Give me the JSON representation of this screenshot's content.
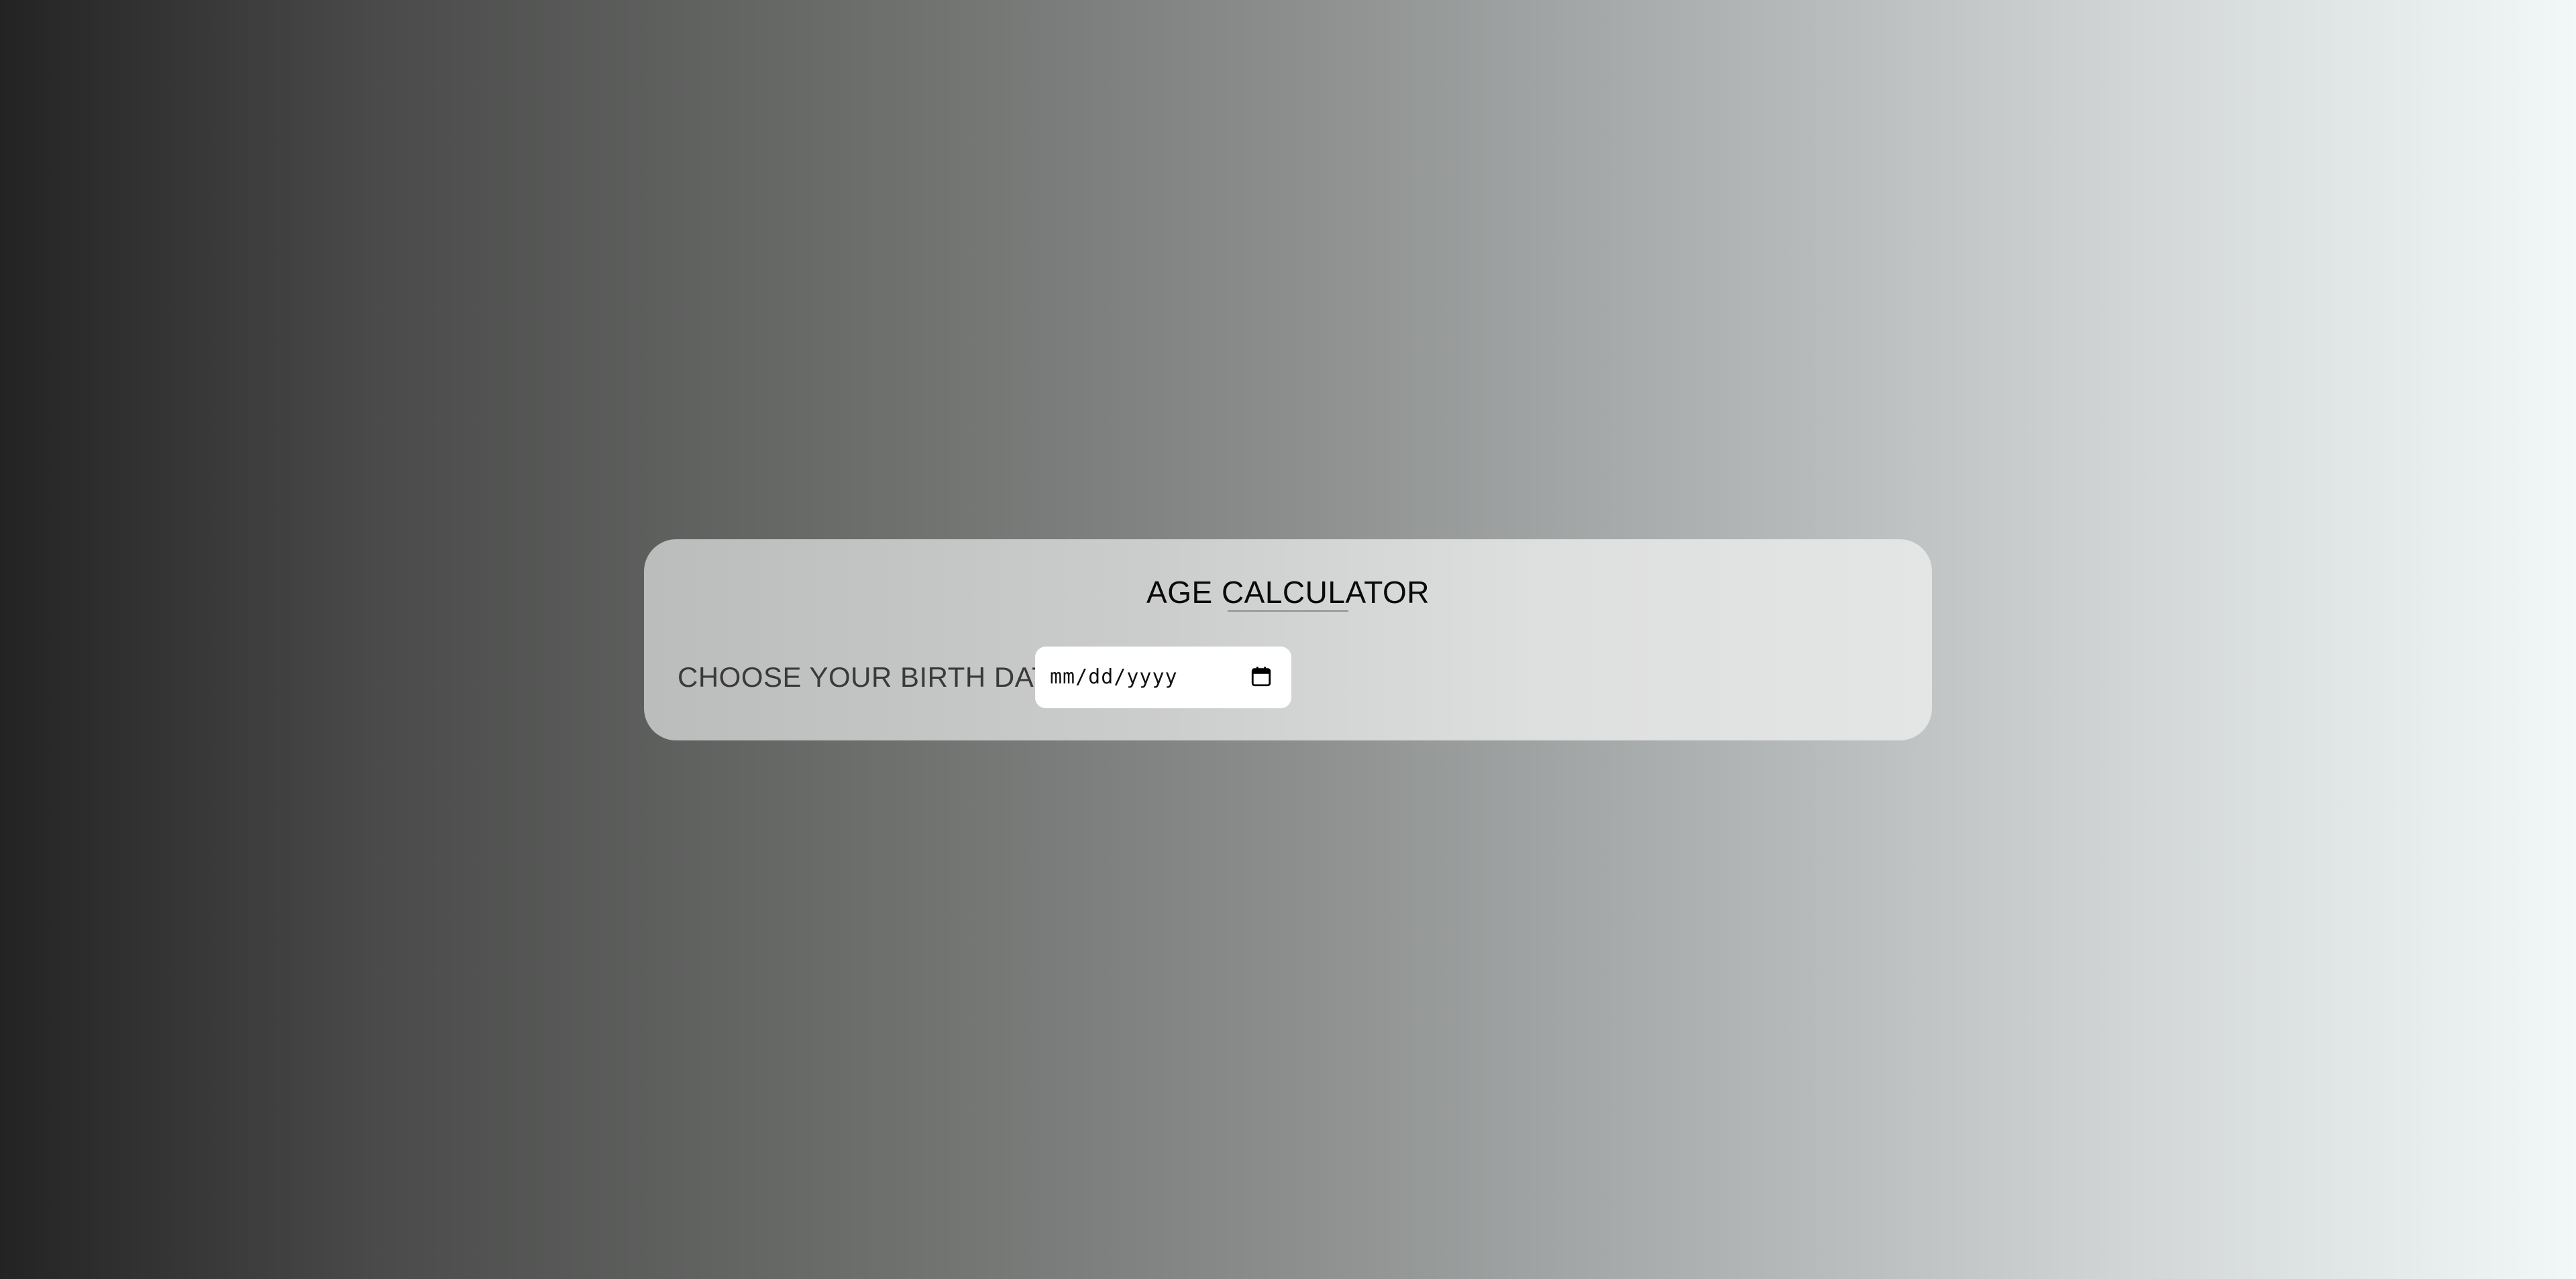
{
  "app": {
    "title": "AGE CALCULATOR"
  },
  "form": {
    "label": "CHOOSE YOUR BIRTH DATE",
    "date_input": {
      "placeholder": "mm/dd/yyyy",
      "icon": "calendar-icon"
    }
  },
  "colors": {
    "background_left": "#232323",
    "background_right": "#f2f7f7",
    "card": "#cfd0d0",
    "input_bg": "#ffffff",
    "title_text": "#0a0a0a",
    "label_text": "#3a3a3a"
  }
}
